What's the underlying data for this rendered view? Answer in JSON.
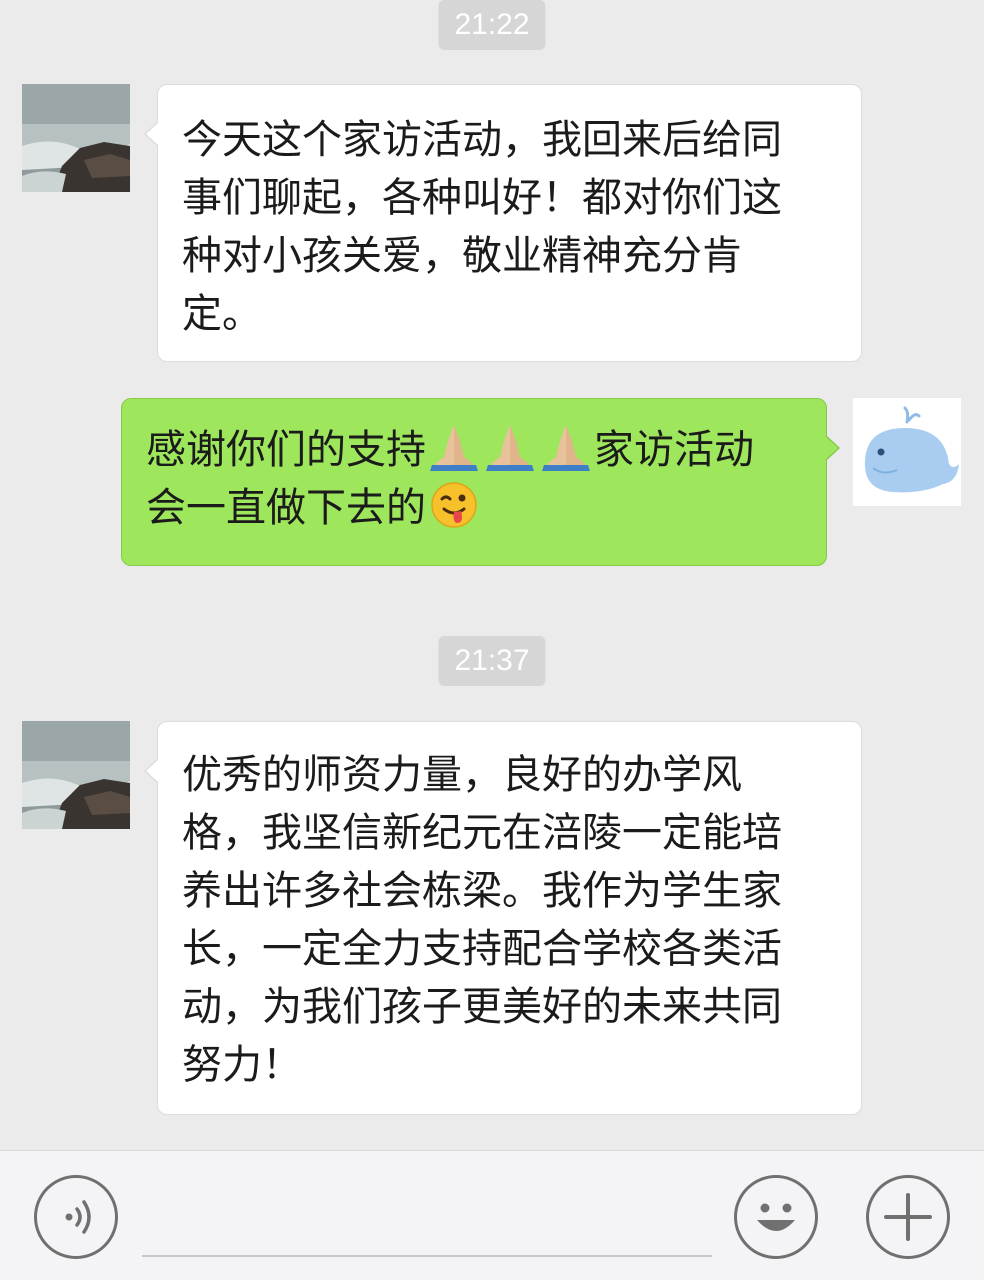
{
  "conversation": {
    "messages": [
      {
        "type": "timestamp",
        "text": "21:22"
      },
      {
        "type": "incoming",
        "lines": [
          "今天这个家访活动，我回来后给同",
          "事们聊起，各种叫好！都对你们这",
          "种对小孩关爱，敬业精神充分肯",
          "定。"
        ]
      },
      {
        "type": "outgoing",
        "line1_text": "感谢你们的支持",
        "line1_tail": "家访活动",
        "line2_text": "会一直做下去的",
        "emoji_line1": "folded-hands-icon x3",
        "emoji_line2": "winking-tongue-face-icon"
      },
      {
        "type": "timestamp",
        "text": "21:37"
      },
      {
        "type": "incoming",
        "lines": [
          "优秀的师资力量，良好的办学风",
          "格，我坚信新纪元在涪陵一定能培",
          "养出许多社会栋梁。我作为学生家",
          "长，一定全力支持配合学校各类活",
          "动，为我们孩子更美好的未来共同",
          "努力！"
        ]
      }
    ]
  },
  "input_bar": {
    "voice_icon": "voice-input-icon",
    "text_value": "",
    "emoji_icon": "emoji-smiley-icon",
    "more_icon": "plus-icon"
  },
  "colors": {
    "background": "#ebebeb",
    "incoming_bubble": "#ffffff",
    "outgoing_bubble": "#9ee75c",
    "timestamp_bg": "#d6d6d6"
  }
}
